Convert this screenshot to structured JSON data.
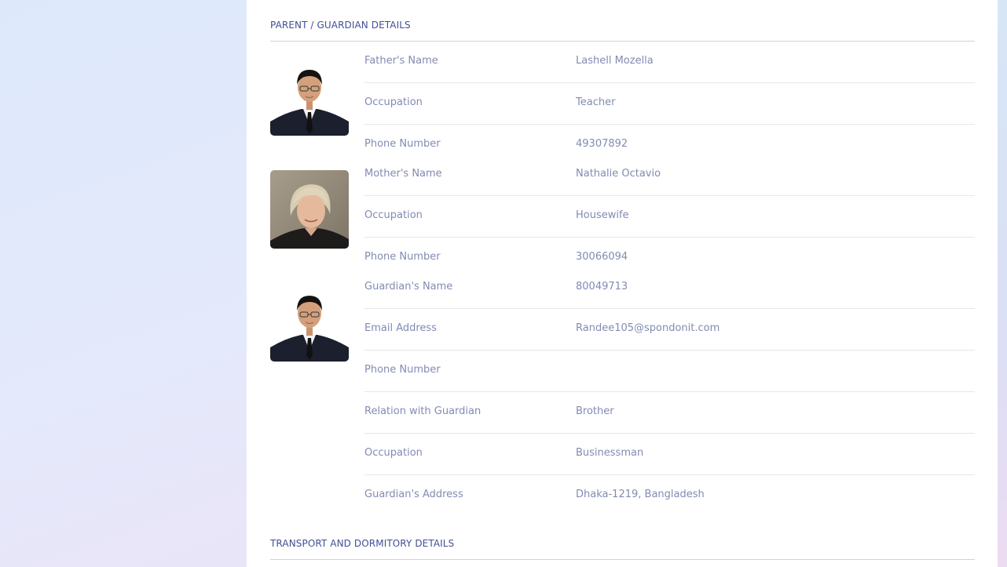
{
  "parent_section": {
    "title": "PARENT / GUARDIAN DETAILS",
    "father": {
      "photo_icon": "father-photo",
      "rows": [
        {
          "label": "Father's Name",
          "value": "Lashell Mozella"
        },
        {
          "label": "Occupation",
          "value": "Teacher"
        },
        {
          "label": "Phone Number",
          "value": "49307892"
        }
      ]
    },
    "mother": {
      "photo_icon": "mother-photo",
      "rows": [
        {
          "label": "Mother's Name",
          "value": "Nathalie Octavio"
        },
        {
          "label": "Occupation",
          "value": "Housewife"
        },
        {
          "label": "Phone Number",
          "value": "30066094"
        }
      ]
    },
    "guardian": {
      "photo_icon": "guardian-photo",
      "rows": [
        {
          "label": "Guardian's Name",
          "value": "80049713"
        },
        {
          "label": "Email Address",
          "value": "Randee105@spondonit.com"
        },
        {
          "label": "Phone Number",
          "value": ""
        },
        {
          "label": "Relation with Guardian",
          "value": "Brother"
        },
        {
          "label": "Occupation",
          "value": "Businessman"
        },
        {
          "label": "Guardian's Address",
          "value": "Dhaka-1219, Bangladesh"
        }
      ]
    }
  },
  "transport_section": {
    "title": "TRANSPORT AND DORMITORY DETAILS"
  },
  "colors": {
    "section_title": "#415094",
    "text": "#828bb2",
    "rule": "#e4e6ee"
  }
}
